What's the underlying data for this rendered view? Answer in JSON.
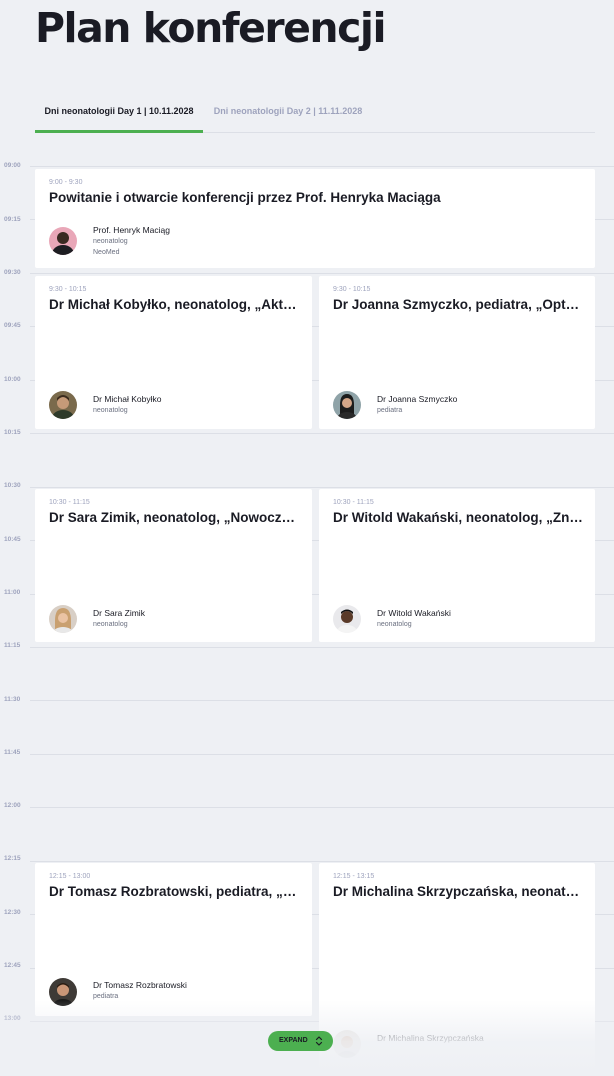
{
  "page": {
    "title": "Plan konferencji"
  },
  "tabs": [
    {
      "label": "Dni neonatologii Day 1 | 10.11.2028",
      "active": true
    },
    {
      "label": "Dni neonatologii Day 2 | 11.11.2028",
      "active": false
    }
  ],
  "timeline": {
    "hours": [
      "09:00",
      "09:15",
      "09:30",
      "09:45",
      "10:00",
      "10:15",
      "10:30",
      "10:45",
      "11:00",
      "11:15",
      "11:30",
      "11:45",
      "12:00",
      "12:15",
      "12:30",
      "12:45",
      "13:00"
    ]
  },
  "sessions": [
    {
      "time": "9:00 - 9:30",
      "title": "Powitanie i otwarcie konferencji przez Prof. Henryka Maciąga",
      "speaker": {
        "name": "Prof. Henryk Maciąg",
        "role": "neonatolog",
        "org": "NeoMed"
      }
    },
    {
      "time": "9:30 - 10:15",
      "title": "Dr Michał Kobyłko, neonatolog, „Aktualne zalecenia”",
      "speaker": {
        "name": "Dr Michał Kobyłko",
        "role": "neonatolog"
      }
    },
    {
      "time": "9:30 - 10:15",
      "title": "Dr Joanna Szmyczko, pediatra, „Optymalizacja”",
      "speaker": {
        "name": "Dr Joanna Szmyczko",
        "role": "pediatra"
      }
    },
    {
      "time": "10:30 - 11:15",
      "title": "Dr Sara Zimik, neonatolog, „Nowoczesne metody”",
      "speaker": {
        "name": "Dr Sara Zimik",
        "role": "neonatolog"
      }
    },
    {
      "time": "10:30 - 11:15",
      "title": "Dr Witold Wakański, neonatolog, „Znaczenie”",
      "speaker": {
        "name": "Dr Witold Wakański",
        "role": "neonatolog"
      }
    },
    {
      "time": "12:15 - 13:00",
      "title": "Dr Tomasz Rozbratowski, pediatra, „Profilaktyka”",
      "speaker": {
        "name": "Dr Tomasz Rozbratowski",
        "role": "pediatra"
      }
    },
    {
      "time": "12:15 - 13:15",
      "title": "Dr Michalina Skrzypczańska, neonatolog",
      "speaker": {
        "name": "Dr Michalina Skrzypczańska",
        "role": ""
      }
    }
  ],
  "expand": {
    "label": "EXPAND",
    "icon": "chevron-up-down-icon"
  },
  "colors": {
    "accent": "#4caf50",
    "background": "#eef0f4",
    "card": "#ffffff",
    "muted": "#9ea3bd"
  }
}
